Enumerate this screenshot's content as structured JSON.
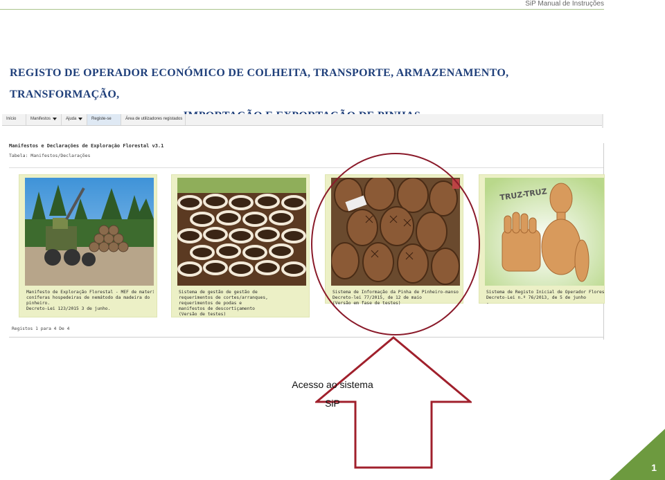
{
  "header": {
    "doc_title": "SiP Manual de Instruções"
  },
  "title": {
    "line1": "REGISTO DE OPERADOR ECONÓMICO DE COLHEITA, TRANSPORTE, ARMAZENAMENTO, TRANSFORMAÇÃO,",
    "line2": "IMPORTAÇÃO E EXPORTAÇÃO DE PINHAS"
  },
  "screenshot": {
    "nav": [
      {
        "label": "Início",
        "dropdown": false
      },
      {
        "label": "Manifestos",
        "dropdown": true
      },
      {
        "label": "Ajuda",
        "dropdown": true
      },
      {
        "label": "Registe-se",
        "dropdown": false
      },
      {
        "label": "Área de utilizadores registados",
        "dropdown": false
      }
    ],
    "app_title": "Manifestos e Declarações de Exploração Florestal v3.1",
    "table_label": "Tabela: Manifestos/Declarações",
    "cards": [
      {
        "lines": [
          "Manifesto de Exploração Florestal - MEF de material de",
          "coníferas hospedeiras de nemátodo da madeira do",
          "pinheiro.",
          "Decreto-Lei 123/2015 3 de junho."
        ]
      },
      {
        "lines": [
          "Sistema de gestão de gestão de",
          "requerimentos de cortes/arranques,",
          "requerimentos de podas e",
          "manifestos de descortiçamento",
          "(Versão de testes)"
        ]
      },
      {
        "lines": [
          "Sistema de Informação da Pinha de Pinheiro-manso (SiP).",
          "Decreto-lei 77/2015, de 12 de maio",
          "(Versão em fase de testes)"
        ]
      },
      {
        "lines": [
          "Sistema de Registo Inicial de Operador Florestal - RIOF",
          "Decreto-Lei n.º 76/2013, de 5 de junho",
          "-"
        ]
      }
    ],
    "records_text": "Registos 1 para 4 De 4",
    "card4_image_text": "TRUZ-TRUZ"
  },
  "callout": {
    "line1": "Acesso ao sistema",
    "line2": "SiP"
  },
  "page_number": "1",
  "colors": {
    "title": "#1f3f7a",
    "circle": "#8a1a2a",
    "arrow": "#a0202c",
    "corner": "#6d9a3f"
  }
}
